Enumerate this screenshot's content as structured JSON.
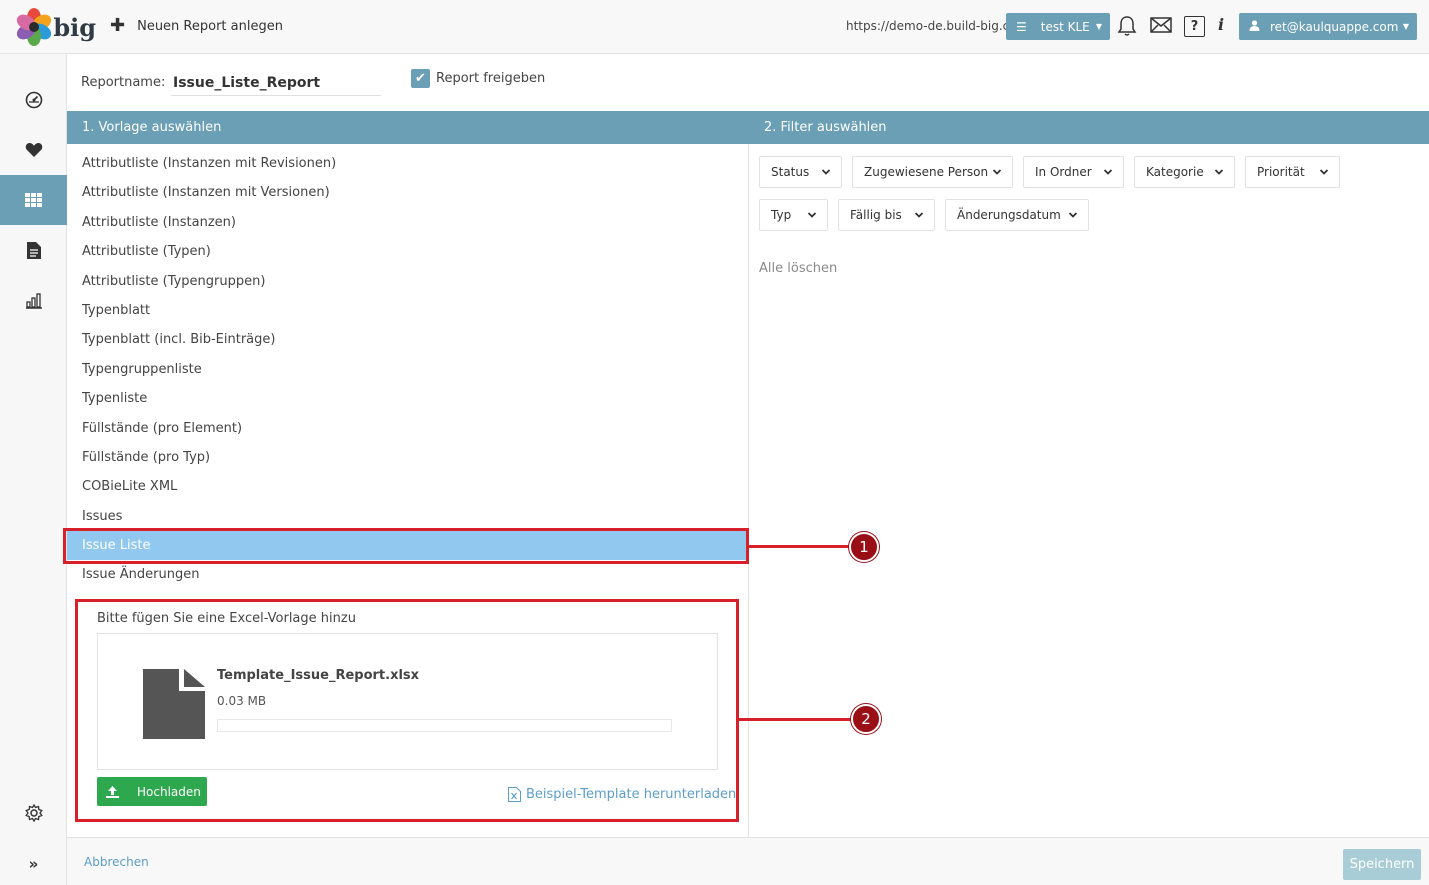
{
  "header": {
    "logo_text": "big",
    "new_report_label": "Neuen Report anlegen",
    "url": "https://demo-de.build-big.ch",
    "project_label": "test KLE",
    "user_label": "ret@kaulquappe.com",
    "help_icon_text": "?",
    "info_icon_text": "i"
  },
  "sidebar": {
    "items": [
      {
        "name": "dashboard-icon"
      },
      {
        "name": "favorites-heart-icon"
      },
      {
        "name": "grid-apps-icon"
      },
      {
        "name": "document-icon"
      },
      {
        "name": "reports-chart-icon"
      }
    ],
    "settings_icon": "gear-icon",
    "expand_icon": "double-chevron-right-icon"
  },
  "form": {
    "reportname_label": "Reportname:",
    "reportname_value": "Issue_Liste_Report",
    "freigeben_label": "Report freigeben",
    "freigeben_checked": true
  },
  "sections": {
    "left_title": "1. Vorlage auswählen",
    "right_title": "2. Filter auswählen"
  },
  "templates": [
    "Attributliste (Instanzen mit Revisionen)",
    "Attributliste (Instanzen mit Versionen)",
    "Attributliste (Instanzen)",
    "Attributliste (Typen)",
    "Attributliste (Typengruppen)",
    "Typenblatt",
    "Typenblatt (incl. Bib-Einträge)",
    "Typengruppenliste",
    "Typenliste",
    "Füllstände (pro Element)",
    "Füllstände (pro Typ)",
    "COBieLite XML",
    "Issues",
    "Issue Liste",
    "Issue Änderungen"
  ],
  "selected_template": "Issue Liste",
  "upload": {
    "title": "Bitte fügen Sie eine Excel-Vorlage hinzu",
    "file_name": "Template_Issue_Report.xlsx",
    "file_size": "0.03 MB",
    "progress": 0,
    "upload_button": "Hochladen",
    "sample_link": "Beispiel-Template herunterladen"
  },
  "filters": {
    "row1": [
      "Status",
      "Zugewiesene Person",
      "In Ordner",
      "Kategorie",
      "Priorität"
    ],
    "row2": [
      "Typ",
      "Fällig bis",
      "Änderungsdatum"
    ],
    "clear_all": "Alle löschen"
  },
  "footer": {
    "cancel": "Abbrechen",
    "save": "Speichern"
  },
  "annotations": {
    "marker1": "1",
    "marker2": "2"
  },
  "colors": {
    "accent": "#6b9fb5",
    "selected_row": "#90c8f0",
    "annotation_red": "#d8202a",
    "upload_green": "#2ea84e",
    "link_blue": "#5b9ec9"
  }
}
